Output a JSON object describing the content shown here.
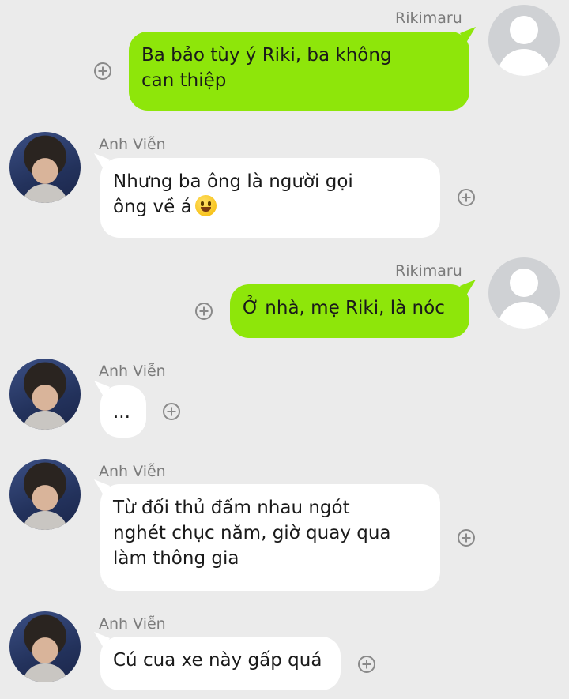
{
  "messages": [
    {
      "sender": "Rikimaru",
      "line1": "Ba bảo tùy ý Riki, ba không",
      "line2": "can thiệp"
    },
    {
      "sender": "Anh Viễn",
      "line1": "Nhưng ba ông là người gọi",
      "line2": "ông về á"
    },
    {
      "sender": "Rikimaru",
      "line1": "Ở nhà, mẹ Riki, là nóc"
    },
    {
      "sender": "Anh Viễn",
      "line1": "..."
    },
    {
      "sender": "Anh Viễn",
      "line1": "Từ đối thủ đấm nhau ngót",
      "line2": "nghét chục năm, giờ quay qua",
      "line3": "làm thông gia"
    },
    {
      "sender": "Anh Viễn",
      "line1": "Cú cua xe này gấp quá"
    }
  ],
  "icons": {
    "add": "plus-circle-icon",
    "emoji": "grinning-face-emoji-icon",
    "default_avatar": "default-user-avatar-icon"
  },
  "colors": {
    "outgoing_bubble": "#8ee60a",
    "incoming_bubble": "#ffffff",
    "background": "#ebebeb"
  }
}
